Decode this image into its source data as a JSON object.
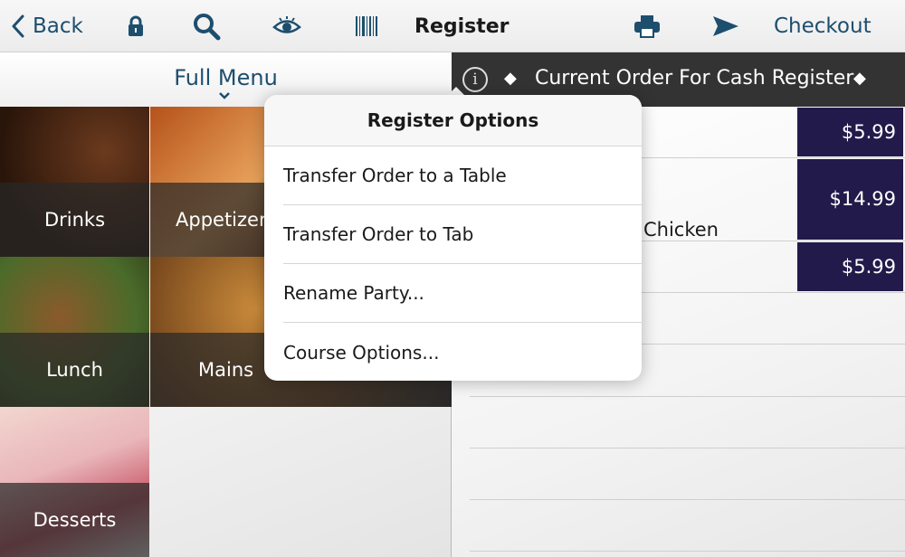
{
  "toolbar": {
    "back_label": "Back",
    "title": "Register",
    "checkout_label": "Checkout",
    "icons": [
      "back-chevron-icon",
      "lock-icon",
      "search-icon",
      "eye-icon",
      "barcode-icon",
      "printer-icon",
      "send-icon"
    ]
  },
  "menu": {
    "title": "Full Menu",
    "categories": [
      {
        "label": "Drinks"
      },
      {
        "label": "Appetizer"
      },
      {
        "label": "Lunch"
      },
      {
        "label": "Mains"
      },
      {
        "label": "Desserts"
      }
    ]
  },
  "order": {
    "header_title": "Current Order For Cash Register",
    "items": [
      {
        "name": "",
        "price": "$5.99"
      },
      {
        "name": "Chicken",
        "price": "$14.99"
      },
      {
        "name": "",
        "price": "$5.99"
      }
    ]
  },
  "popover": {
    "title": "Register Options",
    "items": [
      {
        "label": "Transfer Order to a Table"
      },
      {
        "label": "Transfer Order to Tab"
      },
      {
        "label": "Rename Party..."
      },
      {
        "label": "Course Options..."
      }
    ]
  },
  "colors": {
    "accent": "#1d4e6e",
    "price_bg": "#221a4a",
    "order_header_bg": "#333333"
  }
}
